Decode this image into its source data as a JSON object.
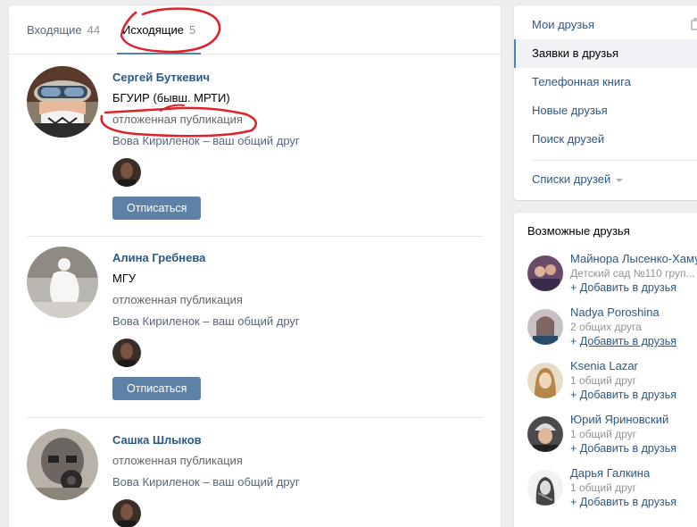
{
  "tabs": {
    "incoming_label": "Входящие",
    "incoming_count": "44",
    "outgoing_label": "Исходящие",
    "outgoing_count": "5"
  },
  "requests": [
    {
      "name": "Сергей Буткевич",
      "line1": "БГУИР (бывш. МРТИ)",
      "line2": "отложенная публикация",
      "mutual": "Вова Кириленок – ваш общий друг",
      "button": "Отписаться"
    },
    {
      "name": "Алина Гребнева",
      "line1": "МГУ",
      "line2": "отложенная публикация",
      "mutual": "Вова Кириленок – ваш общий друг",
      "button": "Отписаться"
    },
    {
      "name": "Сашка Шлыков",
      "line1": "отложенная публикация",
      "mutual": "Вова Кириленок – ваш общий друг"
    }
  ],
  "menu": {
    "items": [
      {
        "label": "Мои друзья"
      },
      {
        "label": "Заявки в друзья"
      },
      {
        "label": "Телефонная книга"
      },
      {
        "label": "Новые друзья"
      },
      {
        "label": "Поиск друзей"
      }
    ],
    "lists_label": "Списки друзей",
    "active_color": "#5181b8"
  },
  "possible_friends": {
    "title": "Возможные друзья",
    "add_label": "Добавить в друзья",
    "people": [
      {
        "name": "Майнора Лысенко-Хамуд",
        "sub": "Детский сад №110 груп..."
      },
      {
        "name": "Nadya Poroshina",
        "sub": "2 общих друга"
      },
      {
        "name": "Ksenia Lazar",
        "sub": "1 общий друг"
      },
      {
        "name": "Юрий Яриновский",
        "sub": "1 общий друг"
      },
      {
        "name": "Дарья Галкина",
        "sub": "1 общий друг"
      }
    ]
  },
  "colors": {
    "link": "#2a5885",
    "button": "#5e81a8",
    "annotation": "#e0202a"
  }
}
